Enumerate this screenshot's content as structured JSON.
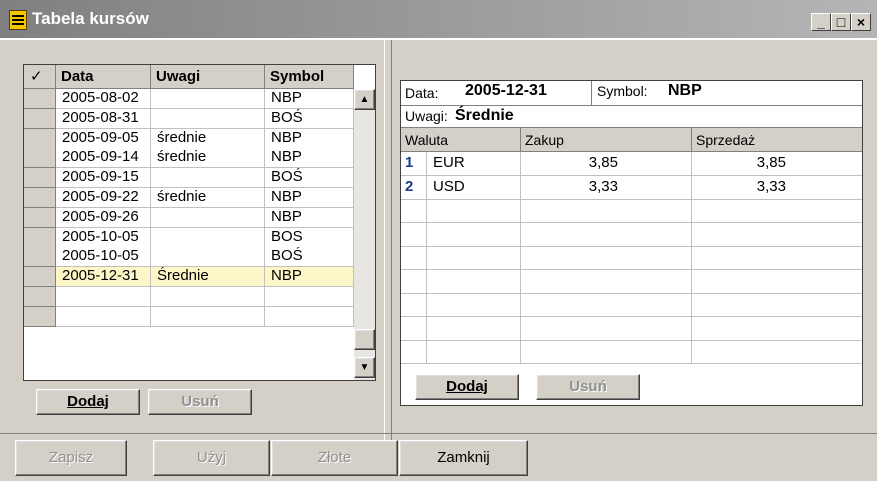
{
  "window": {
    "title": "Tabela kursów",
    "controls": [
      "_",
      "□",
      "×"
    ]
  },
  "left_table": {
    "columns": [
      "Data",
      "Uwagi",
      "Symbol"
    ],
    "rows": [
      {
        "data": "2005-08-02",
        "uwagi": "",
        "symbol": "NBP"
      },
      {
        "data": "2005-08-31",
        "uwagi": "",
        "symbol": "BOŚ"
      },
      {
        "data": "2005-09-05",
        "uwagi": "średnie",
        "symbol": "NBP"
      },
      {
        "data": "2005-09-14",
        "uwagi": "średnie",
        "symbol": "NBP"
      },
      {
        "data": "2005-09-15",
        "uwagi": "",
        "symbol": "BOŚ"
      },
      {
        "data": "2005-09-22",
        "uwagi": "średnie",
        "symbol": "NBP"
      },
      {
        "data": "2005-09-26",
        "uwagi": "",
        "symbol": "NBP"
      },
      {
        "data": "2005-10-05",
        "uwagi": "",
        "symbol": "BOS"
      },
      {
        "data": "2005-10-05",
        "uwagi": "",
        "symbol": "BOŚ"
      },
      {
        "data": "2005-12-31",
        "uwagi": "Średnie",
        "symbol": "NBP"
      },
      {
        "data": "",
        "uwagi": "",
        "symbol": ""
      },
      {
        "data": "",
        "uwagi": "",
        "symbol": ""
      }
    ],
    "selected_row": 9,
    "add_label": "Dodaj",
    "remove_label": "Usuń"
  },
  "detail": {
    "data_label": "Data:",
    "data_value": "2005-12-31",
    "symbol_label": "Symbol:",
    "symbol_value": "NBP",
    "uwagi_label": "Uwagi:",
    "uwagi_value": "Średnie",
    "columns": [
      "Waluta",
      "Zakup",
      "Sprzedaż"
    ],
    "rows": [
      {
        "num": "1",
        "waluta": "EUR",
        "zakup": "3,85",
        "sprzedaz": "3,85"
      },
      {
        "num": "2",
        "waluta": "USD",
        "zakup": "3,33",
        "sprzedaz": "3,33"
      }
    ],
    "add_label": "Dodaj",
    "remove_label": "Usuń"
  },
  "footer": {
    "zapisz": "Zapisz",
    "uzyj": "Użyj",
    "zlote": "Złote",
    "zamknij": "Zamknij"
  }
}
